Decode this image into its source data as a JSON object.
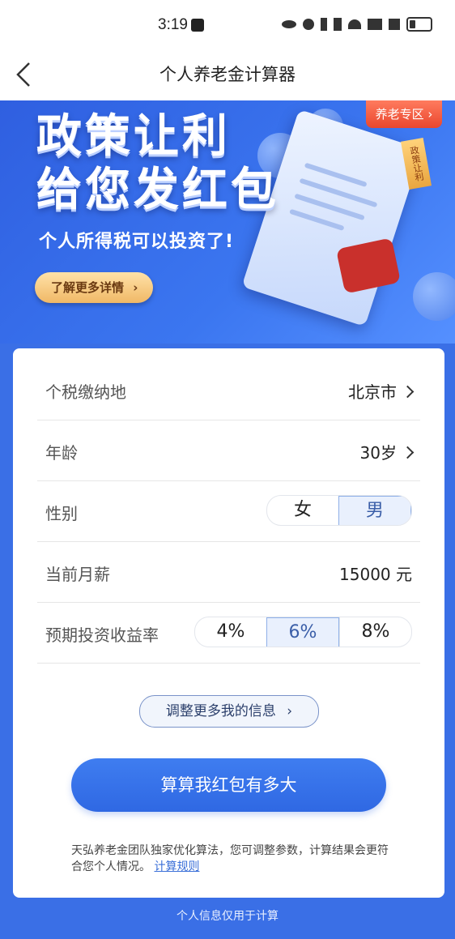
{
  "status": {
    "time": "3:19"
  },
  "header": {
    "title": "个人养老金计算器"
  },
  "banner": {
    "line1": "政策让利",
    "line2": "给您发红包",
    "subtitle": "个人所得税可以投资了!",
    "more_label": "了解更多详情",
    "zone_label": "养老专区",
    "ribbon_label": "政策让利"
  },
  "form": {
    "location": {
      "label": "个税缴纳地",
      "value": "北京市"
    },
    "age": {
      "label": "年龄",
      "value": "30岁"
    },
    "gender": {
      "label": "性别",
      "options": [
        "女",
        "男"
      ],
      "selected": "男"
    },
    "salary": {
      "label": "当前月薪",
      "value": "15000 元"
    },
    "rate": {
      "label": "预期投资收益率",
      "options": [
        "4%",
        "6%",
        "8%"
      ],
      "selected": "6%"
    }
  },
  "more_info_label": "调整更多我的信息",
  "cta_label": "算算我红包有多大",
  "note": {
    "text": "天弘养老金团队独家优化算法，您可调整参数，计算结果会更符合您个人情况。",
    "link": "计算规则"
  },
  "footer": "个人信息仅用于计算"
}
